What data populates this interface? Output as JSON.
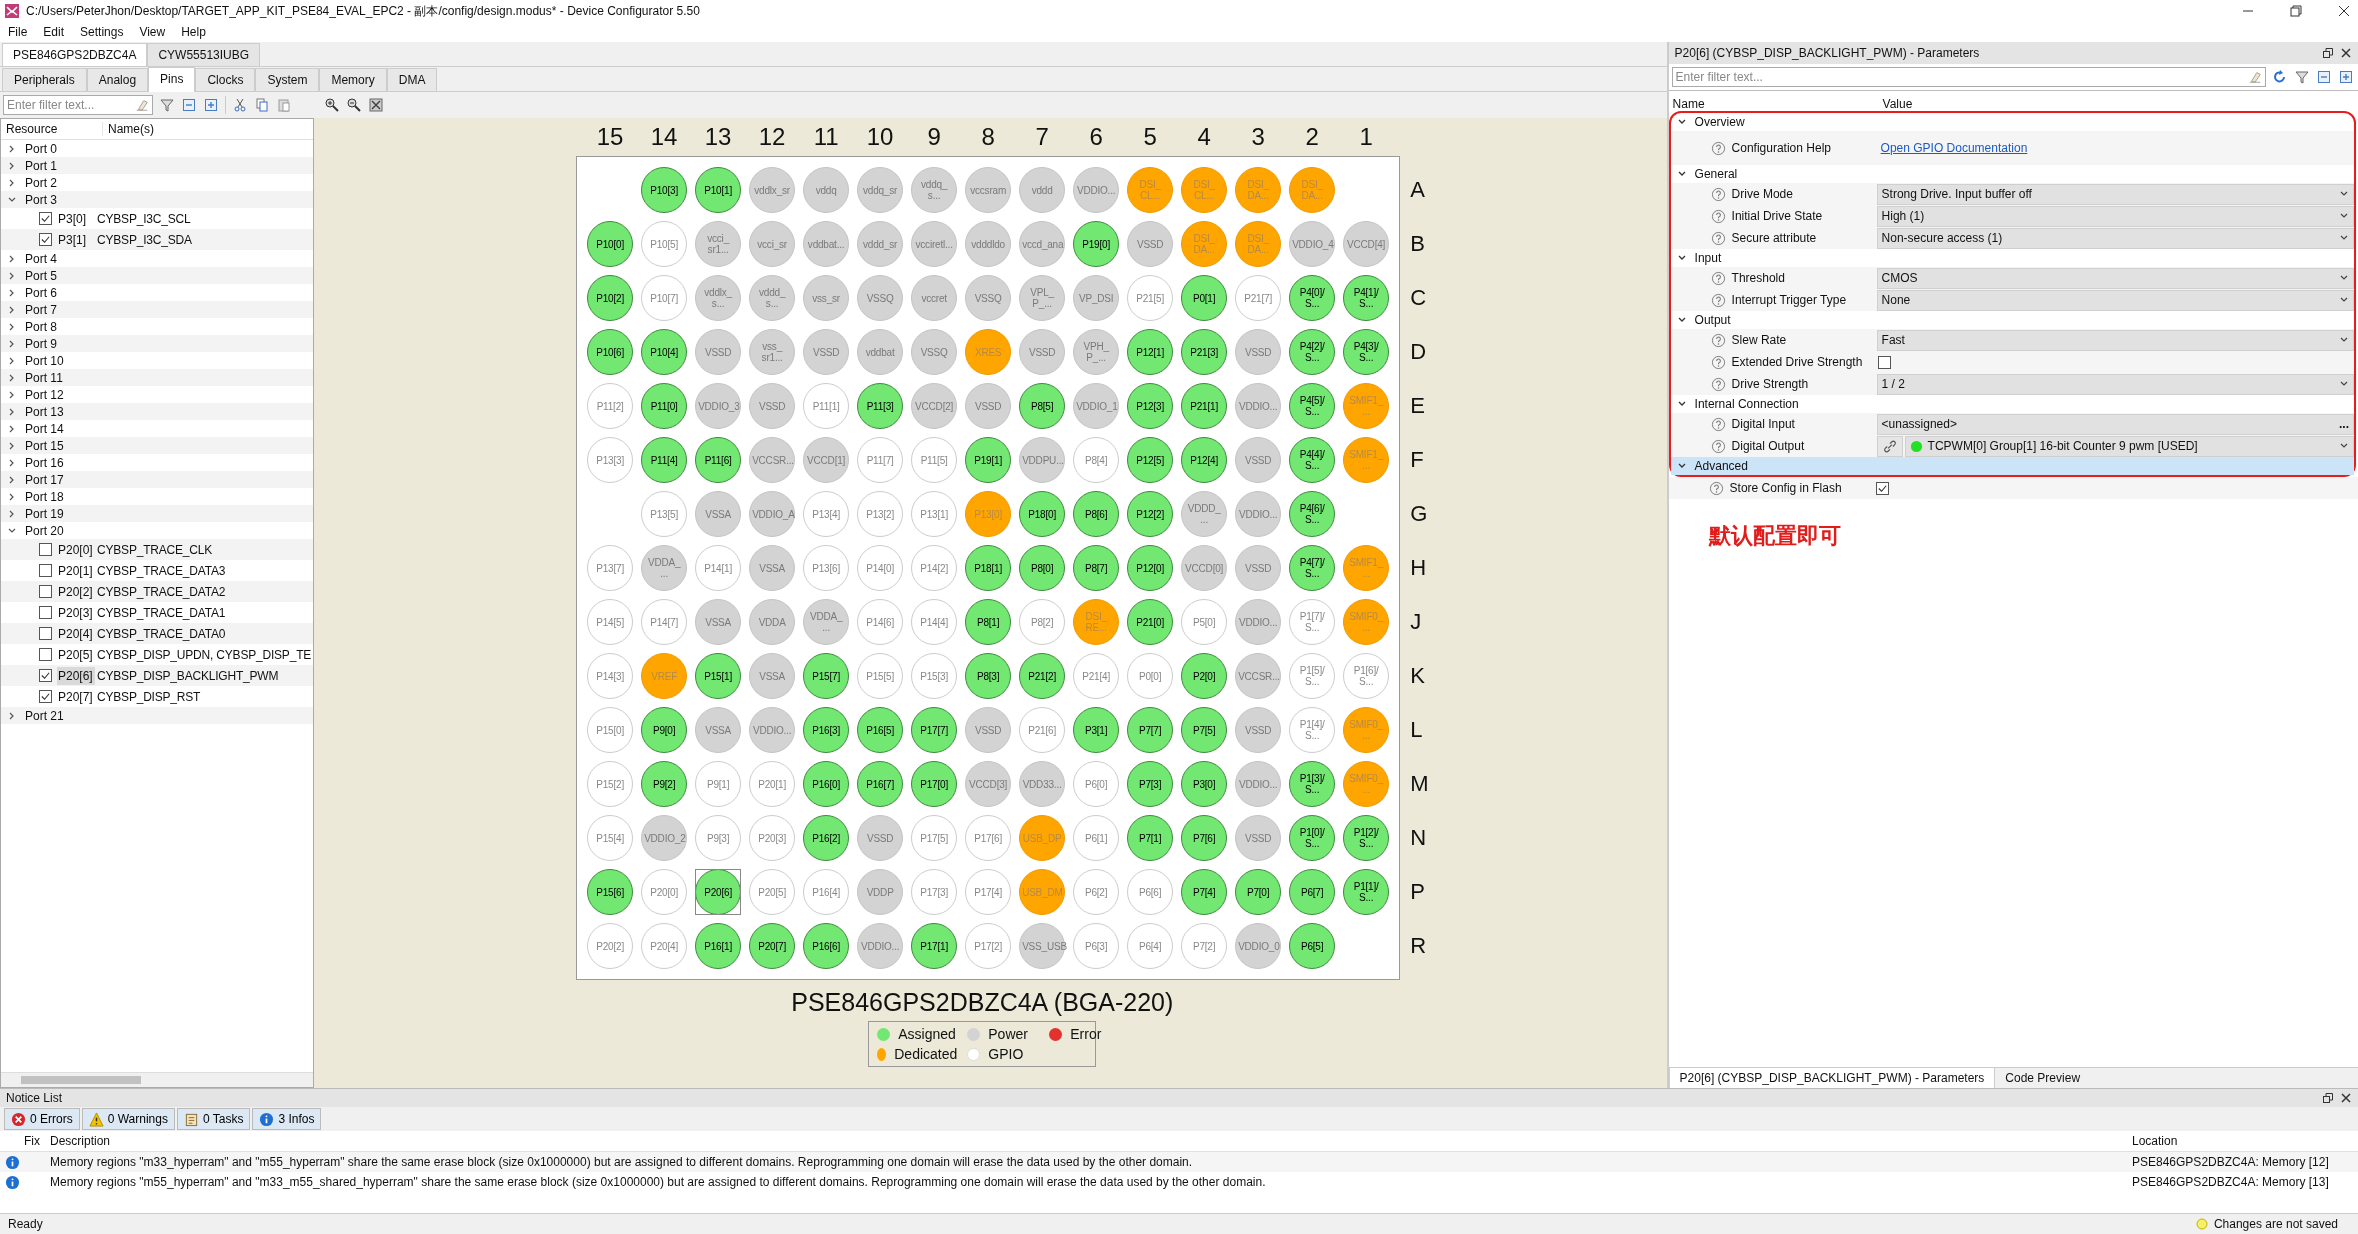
{
  "window": {
    "title": "C:/Users/PeterJhon/Desktop/TARGET_APP_KIT_PSE84_EVAL_EPC2 - 副本/config/design.modus* - Device Configurator 5.50"
  },
  "menu": [
    "File",
    "Edit",
    "Settings",
    "View",
    "Help"
  ],
  "device_tabs": [
    {
      "label": "PSE846GPS2DBZC4A",
      "selected": true
    },
    {
      "label": "CYW55513IUBG",
      "selected": false
    }
  ],
  "view_tabs": [
    {
      "label": "Peripherals",
      "selected": false
    },
    {
      "label": "Analog",
      "selected": false
    },
    {
      "label": "Pins",
      "selected": true
    },
    {
      "label": "Clocks",
      "selected": false
    },
    {
      "label": "System",
      "selected": false
    },
    {
      "label": "Memory",
      "selected": false
    },
    {
      "label": "DMA",
      "selected": false
    }
  ],
  "resource_filter": {
    "placeholder": "Enter filter text..."
  },
  "tree": {
    "columns": [
      "Resource",
      "Name(s)"
    ],
    "items": [
      {
        "label": "Port 0",
        "expanded": false
      },
      {
        "label": "Port 1",
        "expanded": false
      },
      {
        "label": "Port 2",
        "expanded": false
      },
      {
        "label": "Port 3",
        "expanded": true,
        "children": [
          {
            "label": "P3[0]",
            "name": "CYBSP_I3C_SCL",
            "checked": true,
            "selected": false
          },
          {
            "label": "P3[1]",
            "name": "CYBSP_I3C_SDA",
            "checked": true,
            "selected": false
          }
        ]
      },
      {
        "label": "Port 4",
        "expanded": false
      },
      {
        "label": "Port 5",
        "expanded": false
      },
      {
        "label": "Port 6",
        "expanded": false
      },
      {
        "label": "Port 7",
        "expanded": false
      },
      {
        "label": "Port 8",
        "expanded": false
      },
      {
        "label": "Port 9",
        "expanded": false
      },
      {
        "label": "Port 10",
        "expanded": false
      },
      {
        "label": "Port 11",
        "expanded": false
      },
      {
        "label": "Port 12",
        "expanded": false
      },
      {
        "label": "Port 13",
        "expanded": false
      },
      {
        "label": "Port 14",
        "expanded": false
      },
      {
        "label": "Port 15",
        "expanded": false
      },
      {
        "label": "Port 16",
        "expanded": false
      },
      {
        "label": "Port 17",
        "expanded": false
      },
      {
        "label": "Port 18",
        "expanded": false
      },
      {
        "label": "Port 19",
        "expanded": false
      },
      {
        "label": "Port 20",
        "expanded": true,
        "children": [
          {
            "label": "P20[0]",
            "name": "CYBSP_TRACE_CLK",
            "checked": false,
            "selected": false
          },
          {
            "label": "P20[1]",
            "name": "CYBSP_TRACE_DATA3",
            "checked": false,
            "selected": false
          },
          {
            "label": "P20[2]",
            "name": "CYBSP_TRACE_DATA2",
            "checked": false,
            "selected": false
          },
          {
            "label": "P20[3]",
            "name": "CYBSP_TRACE_DATA1",
            "checked": false,
            "selected": false
          },
          {
            "label": "P20[4]",
            "name": "CYBSP_TRACE_DATA0",
            "checked": false,
            "selected": false
          },
          {
            "label": "P20[5]",
            "name": "CYBSP_DISP_UPDN, CYBSP_DISP_TE",
            "checked": false,
            "selected": false
          },
          {
            "label": "P20[6]",
            "name": "CYBSP_DISP_BACKLIGHT_PWM",
            "checked": true,
            "selected": true
          },
          {
            "label": "P20[7]",
            "name": "CYBSP_DISP_RST",
            "checked": true,
            "selected": false
          }
        ]
      },
      {
        "label": "Port 21",
        "expanded": false
      }
    ]
  },
  "pin_grid": {
    "columns": [
      "15",
      "14",
      "13",
      "12",
      "11",
      "10",
      "9",
      "8",
      "7",
      "6",
      "5",
      "4",
      "3",
      "2",
      "1"
    ],
    "rows": [
      {
        "label": "A",
        "pins": [
          {
            "kind": "empty"
          },
          {
            "label": "P10[3]",
            "kind": "assigned",
            "selected": false
          },
          {
            "label": "P10[1]",
            "kind": "assigned",
            "selected": false
          },
          {
            "label": "vddlx_sr",
            "kind": "power",
            "selected": false
          },
          {
            "label": "vddq",
            "kind": "power",
            "selected": false
          },
          {
            "label": "vddq_sr",
            "kind": "power",
            "selected": false
          },
          {
            "label": "vddq_ s...",
            "kind": "power",
            "selected": false
          },
          {
            "label": "vccsram",
            "kind": "power",
            "selected": false
          },
          {
            "label": "vddd",
            "kind": "power",
            "selected": false
          },
          {
            "label": "VDDIO...",
            "kind": "power",
            "selected": false
          },
          {
            "label": "DSI_ CL...",
            "kind": "dedicated",
            "selected": false
          },
          {
            "label": "DSI_ CL...",
            "kind": "dedicated",
            "selected": false
          },
          {
            "label": "DSI_ DA...",
            "kind": "dedicated",
            "selected": false
          },
          {
            "label": "DSI_ DA...",
            "kind": "dedicated",
            "selected": false
          },
          {
            "kind": "empty"
          }
        ]
      },
      {
        "label": "B",
        "pins": [
          {
            "label": "P10[0]",
            "kind": "assigned",
            "selected": false
          },
          {
            "label": "P10[5]",
            "kind": "gpio",
            "selected": false
          },
          {
            "label": "vcci_ sr1...",
            "kind": "power",
            "selected": false
          },
          {
            "label": "vcci_sr",
            "kind": "power",
            "selected": false
          },
          {
            "label": "vddbat...",
            "kind": "power",
            "selected": false
          },
          {
            "label": "vddd_sr",
            "kind": "power",
            "selected": false
          },
          {
            "label": "vcciretl...",
            "kind": "power",
            "selected": false
          },
          {
            "label": "vdddldo",
            "kind": "power",
            "selected": false
          },
          {
            "label": "vccd_ana",
            "kind": "power",
            "selected": false
          },
          {
            "label": "P19[0]",
            "kind": "assigned",
            "selected": false
          },
          {
            "label": "VSSD",
            "kind": "power",
            "selected": false
          },
          {
            "label": "DSI_ DA...",
            "kind": "dedicated",
            "selected": false
          },
          {
            "label": "DSI_ DA...",
            "kind": "dedicated",
            "selected": false
          },
          {
            "label": "VDDIO_4",
            "kind": "power",
            "selected": false
          },
          {
            "label": "VCCD[4]",
            "kind": "power",
            "selected": false
          }
        ]
      },
      {
        "label": "C",
        "pins": [
          {
            "label": "P10[2]",
            "kind": "assigned",
            "selected": false
          },
          {
            "label": "P10[7]",
            "kind": "gpio",
            "selected": false
          },
          {
            "label": "vddlx_ s...",
            "kind": "power",
            "selected": false
          },
          {
            "label": "vddd_ s...",
            "kind": "power",
            "selected": false
          },
          {
            "label": "vss_sr",
            "kind": "power",
            "selected": false
          },
          {
            "label": "VSSQ",
            "kind": "power",
            "selected": false
          },
          {
            "label": "vccret",
            "kind": "power",
            "selected": false
          },
          {
            "label": "VSSQ",
            "kind": "power",
            "selected": false
          },
          {
            "label": "VPL_ P_...",
            "kind": "power",
            "selected": false
          },
          {
            "label": "VP_DSI",
            "kind": "power",
            "selected": false
          },
          {
            "label": "P21[5]",
            "kind": "gpio",
            "selected": false
          },
          {
            "label": "P0[1]",
            "kind": "assigned",
            "selected": false
          },
          {
            "label": "P21[7]",
            "kind": "gpio",
            "selected": false
          },
          {
            "label": "P4[0]/ S...",
            "kind": "assigned",
            "selected": false
          },
          {
            "label": "P4[1]/ S...",
            "kind": "assigned",
            "selected": false
          }
        ]
      },
      {
        "label": "D",
        "pins": [
          {
            "label": "P10[6]",
            "kind": "assigned",
            "selected": false
          },
          {
            "label": "P10[4]",
            "kind": "assigned",
            "selected": false
          },
          {
            "label": "VSSD",
            "kind": "power",
            "selected": false
          },
          {
            "label": "vss_ sr1...",
            "kind": "power",
            "selected": false
          },
          {
            "label": "VSSD",
            "kind": "power",
            "selected": false
          },
          {
            "label": "vddbat",
            "kind": "power",
            "selected": false
          },
          {
            "label": "VSSQ",
            "kind": "power",
            "selected": false
          },
          {
            "label": "XRES",
            "kind": "dedicated",
            "selected": false
          },
          {
            "label": "VSSD",
            "kind": "power",
            "selected": false
          },
          {
            "label": "VPH_ P_...",
            "kind": "power",
            "selected": false
          },
          {
            "label": "P12[1]",
            "kind": "assigned",
            "selected": false
          },
          {
            "label": "P21[3]",
            "kind": "assigned",
            "selected": false
          },
          {
            "label": "VSSD",
            "kind": "power",
            "selected": false
          },
          {
            "label": "P4[2]/ S...",
            "kind": "assigned",
            "selected": false
          },
          {
            "label": "P4[3]/ S...",
            "kind": "assigned",
            "selected": false
          }
        ]
      },
      {
        "label": "E",
        "pins": [
          {
            "label": "P11[2]",
            "kind": "gpio",
            "selected": false
          },
          {
            "label": "P11[0]",
            "kind": "assigned",
            "selected": false
          },
          {
            "label": "VDDIO_3",
            "kind": "power",
            "selected": false
          },
          {
            "label": "VSSD",
            "kind": "power",
            "selected": false
          },
          {
            "label": "P11[1]",
            "kind": "gpio",
            "selected": false
          },
          {
            "label": "P11[3]",
            "kind": "assigned",
            "selected": false
          },
          {
            "label": "VCCD[2]",
            "kind": "power",
            "selected": false
          },
          {
            "label": "VSSD",
            "kind": "power",
            "selected": false
          },
          {
            "label": "P8[5]",
            "kind": "assigned",
            "selected": false
          },
          {
            "label": "VDDIO_1",
            "kind": "power",
            "selected": false
          },
          {
            "label": "P12[3]",
            "kind": "assigned",
            "selected": false
          },
          {
            "label": "P21[1]",
            "kind": "assigned",
            "selected": false
          },
          {
            "label": "VDDIO...",
            "kind": "power",
            "selected": false
          },
          {
            "label": "P4[5]/ S...",
            "kind": "assigned",
            "selected": false
          },
          {
            "label": "SMIF1_ ...",
            "kind": "dedicated",
            "selected": false
          }
        ]
      },
      {
        "label": "F",
        "pins": [
          {
            "label": "P13[3]",
            "kind": "gpio",
            "selected": false
          },
          {
            "label": "P11[4]",
            "kind": "assigned",
            "selected": false
          },
          {
            "label": "P11[6]",
            "kind": "assigned",
            "selected": false
          },
          {
            "label": "VCCSR...",
            "kind": "power",
            "selected": false
          },
          {
            "label": "VCCD[1]",
            "kind": "power",
            "selected": false
          },
          {
            "label": "P11[7]",
            "kind": "gpio",
            "selected": false
          },
          {
            "label": "P11[5]",
            "kind": "gpio",
            "selected": false
          },
          {
            "label": "P19[1]",
            "kind": "assigned",
            "selected": false
          },
          {
            "label": "VDDPU...",
            "kind": "power",
            "selected": false
          },
          {
            "label": "P8[4]",
            "kind": "gpio",
            "selected": false
          },
          {
            "label": "P12[5]",
            "kind": "assigned",
            "selected": false
          },
          {
            "label": "P12[4]",
            "kind": "assigned",
            "selected": false
          },
          {
            "label": "VSSD",
            "kind": "power",
            "selected": false
          },
          {
            "label": "P4[4]/ S...",
            "kind": "assigned",
            "selected": false
          },
          {
            "label": "SMIF1_ ...",
            "kind": "dedicated",
            "selected": false
          }
        ]
      },
      {
        "label": "G",
        "pins": [
          {
            "kind": "empty"
          },
          {
            "label": "P13[5]",
            "kind": "gpio",
            "selected": false
          },
          {
            "label": "VSSA",
            "kind": "power",
            "selected": false
          },
          {
            "label": "VDDIO_A",
            "kind": "power",
            "selected": false
          },
          {
            "label": "P13[4]",
            "kind": "gpio",
            "selected": false
          },
          {
            "label": "P13[2]",
            "kind": "gpio",
            "selected": false
          },
          {
            "label": "P13[1]",
            "kind": "gpio",
            "selected": false
          },
          {
            "label": "P13[0]",
            "kind": "dedicated",
            "selected": false
          },
          {
            "label": "P18[0]",
            "kind": "assigned",
            "selected": false
          },
          {
            "label": "P8[6]",
            "kind": "assigned",
            "selected": false
          },
          {
            "label": "P12[2]",
            "kind": "assigned",
            "selected": false
          },
          {
            "label": "VDDD_ ...",
            "kind": "power",
            "selected": false
          },
          {
            "label": "VDDIO...",
            "kind": "power",
            "selected": false
          },
          {
            "label": "P4[6]/ S...",
            "kind": "assigned",
            "selected": false
          },
          {
            "kind": "empty"
          }
        ]
      },
      {
        "label": "H",
        "pins": [
          {
            "label": "P13[7]",
            "kind": "gpio",
            "selected": false
          },
          {
            "label": "VDDA_ ...",
            "kind": "power",
            "selected": false
          },
          {
            "label": "P14[1]",
            "kind": "gpio",
            "selected": false
          },
          {
            "label": "VSSA",
            "kind": "power",
            "selected": false
          },
          {
            "label": "P13[6]",
            "kind": "gpio",
            "selected": false
          },
          {
            "label": "P14[0]",
            "kind": "gpio",
            "selected": false
          },
          {
            "label": "P14[2]",
            "kind": "gpio",
            "selected": false
          },
          {
            "label": "P18[1]",
            "kind": "assigned",
            "selected": false
          },
          {
            "label": "P8[0]",
            "kind": "assigned",
            "selected": false
          },
          {
            "label": "P8[7]",
            "kind": "assigned",
            "selected": false
          },
          {
            "label": "P12[0]",
            "kind": "assigned",
            "selected": false
          },
          {
            "label": "VCCD[0]",
            "kind": "power",
            "selected": false
          },
          {
            "label": "VSSD",
            "kind": "power",
            "selected": false
          },
          {
            "label": "P4[7]/ S...",
            "kind": "assigned",
            "selected": false
          },
          {
            "label": "SMIF1_ ...",
            "kind": "dedicated",
            "selected": false
          }
        ]
      },
      {
        "label": "J",
        "pins": [
          {
            "label": "P14[5]",
            "kind": "gpio",
            "selected": false
          },
          {
            "label": "P14[7]",
            "kind": "gpio",
            "selected": false
          },
          {
            "label": "VSSA",
            "kind": "power",
            "selected": false
          },
          {
            "label": "VDDA",
            "kind": "power",
            "selected": false
          },
          {
            "label": "VDDA_ ...",
            "kind": "power",
            "selected": false
          },
          {
            "label": "P14[6]",
            "kind": "gpio",
            "selected": false
          },
          {
            "label": "P14[4]",
            "kind": "gpio",
            "selected": false
          },
          {
            "label": "P8[1]",
            "kind": "assigned",
            "selected": false
          },
          {
            "label": "P8[2]",
            "kind": "gpio",
            "selected": false
          },
          {
            "label": "DSI_ RE...",
            "kind": "dedicated",
            "selected": false
          },
          {
            "label": "P21[0]",
            "kind": "assigned",
            "selected": false
          },
          {
            "label": "P5[0]",
            "kind": "gpio",
            "selected": false
          },
          {
            "label": "VDDIO...",
            "kind": "power",
            "selected": false
          },
          {
            "label": "P1[7]/ S...",
            "kind": "gpio",
            "selected": false
          },
          {
            "label": "SMIF0_ ...",
            "kind": "dedicated",
            "selected": false
          }
        ]
      },
      {
        "label": "K",
        "pins": [
          {
            "label": "P14[3]",
            "kind": "gpio",
            "selected": false
          },
          {
            "label": "VREF",
            "kind": "dedicated",
            "selected": false
          },
          {
            "label": "P15[1]",
            "kind": "assigned",
            "selected": false
          },
          {
            "label": "VSSA",
            "kind": "power",
            "selected": false
          },
          {
            "label": "P15[7]",
            "kind": "assigned",
            "selected": false
          },
          {
            "label": "P15[5]",
            "kind": "gpio",
            "selected": false
          },
          {
            "label": "P15[3]",
            "kind": "gpio",
            "selected": false
          },
          {
            "label": "P8[3]",
            "kind": "assigned",
            "selected": false
          },
          {
            "label": "P21[2]",
            "kind": "assigned",
            "selected": false
          },
          {
            "label": "P21[4]",
            "kind": "gpio",
            "selected": false
          },
          {
            "label": "P0[0]",
            "kind": "gpio",
            "selected": false
          },
          {
            "label": "P2[0]",
            "kind": "assigned",
            "selected": false
          },
          {
            "label": "VCCSR...",
            "kind": "power",
            "selected": false
          },
          {
            "label": "P1[5]/ S...",
            "kind": "gpio",
            "selected": false
          },
          {
            "label": "P1[6]/ S...",
            "kind": "gpio",
            "selected": false
          }
        ]
      },
      {
        "label": "L",
        "pins": [
          {
            "label": "P15[0]",
            "kind": "gpio",
            "selected": false
          },
          {
            "label": "P9[0]",
            "kind": "assigned",
            "selected": false
          },
          {
            "label": "VSSA",
            "kind": "power",
            "selected": false
          },
          {
            "label": "VDDIO...",
            "kind": "power",
            "selected": false
          },
          {
            "label": "P16[3]",
            "kind": "assigned",
            "selected": false
          },
          {
            "label": "P16[5]",
            "kind": "assigned",
            "selected": false
          },
          {
            "label": "P17[7]",
            "kind": "assigned",
            "selected": false
          },
          {
            "label": "VSSD",
            "kind": "power",
            "selected": false
          },
          {
            "label": "P21[6]",
            "kind": "gpio",
            "selected": false
          },
          {
            "label": "P3[1]",
            "kind": "assigned",
            "selected": false
          },
          {
            "label": "P7[7]",
            "kind": "assigned",
            "selected": false
          },
          {
            "label": "P7[5]",
            "kind": "assigned",
            "selected": false
          },
          {
            "label": "VSSD",
            "kind": "power",
            "selected": false
          },
          {
            "label": "P1[4]/ S...",
            "kind": "gpio",
            "selected": false
          },
          {
            "label": "SMIF0_ ...",
            "kind": "dedicated",
            "selected": false
          }
        ]
      },
      {
        "label": "M",
        "pins": [
          {
            "label": "P15[2]",
            "kind": "gpio",
            "selected": false
          },
          {
            "label": "P9[2]",
            "kind": "assigned",
            "selected": false
          },
          {
            "label": "P9[1]",
            "kind": "gpio",
            "selected": false
          },
          {
            "label": "P20[1]",
            "kind": "gpio",
            "selected": false
          },
          {
            "label": "P16[0]",
            "kind": "assigned",
            "selected": false
          },
          {
            "label": "P16[7]",
            "kind": "assigned",
            "selected": false
          },
          {
            "label": "P17[0]",
            "kind": "assigned",
            "selected": false
          },
          {
            "label": "VCCD[3]",
            "kind": "power",
            "selected": false
          },
          {
            "label": "VDD33...",
            "kind": "power",
            "selected": false
          },
          {
            "label": "P6[0]",
            "kind": "gpio",
            "selected": false
          },
          {
            "label": "P7[3]",
            "kind": "assigned",
            "selected": false
          },
          {
            "label": "P3[0]",
            "kind": "assigned",
            "selected": false
          },
          {
            "label": "VDDIO...",
            "kind": "power",
            "selected": false
          },
          {
            "label": "P1[3]/ S...",
            "kind": "assigned",
            "selected": false
          },
          {
            "label": "SMIF0_ ...",
            "kind": "dedicated",
            "selected": false
          }
        ]
      },
      {
        "label": "N",
        "pins": [
          {
            "label": "P15[4]",
            "kind": "gpio",
            "selected": false
          },
          {
            "label": "VDDIO_2",
            "kind": "power",
            "selected": false
          },
          {
            "label": "P9[3]",
            "kind": "gpio",
            "selected": false
          },
          {
            "label": "P20[3]",
            "kind": "gpio",
            "selected": false
          },
          {
            "label": "P16[2]",
            "kind": "assigned",
            "selected": false
          },
          {
            "label": "VSSD",
            "kind": "power",
            "selected": false
          },
          {
            "label": "P17[5]",
            "kind": "gpio",
            "selected": false
          },
          {
            "label": "P17[6]",
            "kind": "gpio",
            "selected": false
          },
          {
            "label": "USB_DP",
            "kind": "dedicated",
            "selected": false
          },
          {
            "label": "P6[1]",
            "kind": "gpio",
            "selected": false
          },
          {
            "label": "P7[1]",
            "kind": "assigned",
            "selected": false
          },
          {
            "label": "P7[6]",
            "kind": "assigned",
            "selected": false
          },
          {
            "label": "VSSD",
            "kind": "power",
            "selected": false
          },
          {
            "label": "P1[0]/ S...",
            "kind": "assigned",
            "selected": false
          },
          {
            "label": "P1[2]/ S...",
            "kind": "assigned",
            "selected": false
          }
        ]
      },
      {
        "label": "P",
        "pins": [
          {
            "label": "P15[6]",
            "kind": "assigned",
            "selected": false
          },
          {
            "label": "P20[0]",
            "kind": "gpio",
            "selected": false
          },
          {
            "label": "P20[6]",
            "kind": "assigned",
            "selected": true
          },
          {
            "label": "P20[5]",
            "kind": "gpio",
            "selected": false
          },
          {
            "label": "P16[4]",
            "kind": "gpio",
            "selected": false
          },
          {
            "label": "VDDP",
            "kind": "power",
            "selected": false
          },
          {
            "label": "P17[3]",
            "kind": "gpio",
            "selected": false
          },
          {
            "label": "P17[4]",
            "kind": "gpio",
            "selected": false
          },
          {
            "label": "USB_DM",
            "kind": "dedicated",
            "selected": false
          },
          {
            "label": "P6[2]",
            "kind": "gpio",
            "selected": false
          },
          {
            "label": "P6[6]",
            "kind": "gpio",
            "selected": false
          },
          {
            "label": "P7[4]",
            "kind": "assigned",
            "selected": false
          },
          {
            "label": "P7[0]",
            "kind": "assigned",
            "selected": false
          },
          {
            "label": "P6[7]",
            "kind": "assigned",
            "selected": false
          },
          {
            "label": "P1[1]/ S...",
            "kind": "assigned",
            "selected": false
          }
        ]
      },
      {
        "label": "R",
        "pins": [
          {
            "label": "P20[2]",
            "kind": "gpio",
            "selected": false
          },
          {
            "label": "P20[4]",
            "kind": "gpio",
            "selected": false
          },
          {
            "label": "P16[1]",
            "kind": "assigned",
            "selected": false
          },
          {
            "label": "P20[7]",
            "kind": "assigned",
            "selected": false
          },
          {
            "label": "P16[6]",
            "kind": "assigned",
            "selected": false
          },
          {
            "label": "VDDIO...",
            "kind": "power",
            "selected": false
          },
          {
            "label": "P17[1]",
            "kind": "assigned",
            "selected": false
          },
          {
            "label": "P17[2]",
            "kind": "gpio",
            "selected": false
          },
          {
            "label": "VSS_USB",
            "kind": "power",
            "selected": false
          },
          {
            "label": "P6[3]",
            "kind": "gpio",
            "selected": false
          },
          {
            "label": "P6[4]",
            "kind": "gpio",
            "selected": false
          },
          {
            "label": "P7[2]",
            "kind": "gpio",
            "selected": false
          },
          {
            "label": "VDDIO_0",
            "kind": "power",
            "selected": false
          },
          {
            "label": "P6[5]",
            "kind": "assigned",
            "selected": false
          },
          {
            "kind": "empty"
          }
        ]
      }
    ]
  },
  "package_title": "PSE846GPS2DBZC4A (BGA-220)",
  "legend": [
    {
      "label": "Assigned",
      "kind": "assigned"
    },
    {
      "label": "Power",
      "kind": "power"
    },
    {
      "label": "Error",
      "kind": "error"
    },
    {
      "label": "Dedicated",
      "kind": "dedicated"
    },
    {
      "label": "GPIO",
      "kind": "gpio"
    }
  ],
  "parameters": {
    "title": "P20[6] (CYBSP_DISP_BACKLIGHT_PWM) - Parameters",
    "filter": {
      "placeholder": "Enter filter text..."
    },
    "columns": [
      "Name",
      "Value"
    ],
    "groups": [
      {
        "label": "Overview",
        "expanded": true,
        "selected": false,
        "params": [
          {
            "name": "Configuration Help",
            "kind": "link",
            "value": "Open GPIO Documentation"
          }
        ]
      },
      {
        "label": "General",
        "expanded": true,
        "selected": false,
        "params": [
          {
            "name": "Drive Mode",
            "kind": "dropdown",
            "value": "Strong Drive. Input buffer off"
          },
          {
            "name": "Initial Drive State",
            "kind": "dropdown",
            "value": "High (1)"
          },
          {
            "name": "Secure attribute",
            "kind": "dropdown",
            "value": "Non-secure access (1)"
          }
        ]
      },
      {
        "label": "Input",
        "expanded": true,
        "selected": false,
        "params": [
          {
            "name": "Threshold",
            "kind": "dropdown",
            "value": "CMOS"
          },
          {
            "name": "Interrupt Trigger Type",
            "kind": "dropdown",
            "value": "None"
          }
        ]
      },
      {
        "label": "Output",
        "expanded": true,
        "selected": false,
        "params": [
          {
            "name": "Slew Rate",
            "kind": "dropdown",
            "value": "Fast"
          },
          {
            "name": "Extended Drive Strength",
            "kind": "checkbox",
            "checked": false
          },
          {
            "name": "Drive Strength",
            "kind": "dropdown",
            "value": "1 / 2"
          }
        ]
      },
      {
        "label": "Internal Connection",
        "expanded": true,
        "selected": false,
        "params": [
          {
            "name": "Digital Input",
            "kind": "picker",
            "value": "<unassigned>",
            "button_label": "..."
          },
          {
            "name": "Digital Output",
            "kind": "connection",
            "value": "TCPWM[0] Group[1] 16-bit Counter 9 pwm [USED]"
          }
        ]
      },
      {
        "label": "Advanced",
        "expanded": true,
        "selected": true,
        "params": [
          {
            "name": "Store Config in Flash",
            "kind": "checkbox",
            "checked": true
          }
        ]
      }
    ],
    "annotation": "默认配置即可",
    "bottom_tabs": [
      {
        "label": "P20[6] (CYBSP_DISP_BACKLIGHT_PWM) - Parameters",
        "selected": true
      },
      {
        "label": "Code Preview",
        "selected": false
      }
    ]
  },
  "notice_list": {
    "title": "Notice List",
    "filters": [
      {
        "label": "0 Errors",
        "kind": "error"
      },
      {
        "label": "0 Warnings",
        "kind": "warning"
      },
      {
        "label": "0 Tasks",
        "kind": "task"
      },
      {
        "label": "3 Infos",
        "kind": "info"
      }
    ],
    "columns": [
      "Fix",
      "Description",
      "Location"
    ],
    "rows": [
      {
        "kind": "info",
        "description": "Memory regions \"m33_hyperram\" and \"m55_hyperram\" share the same erase block (size 0x1000000) but are assigned to different domains. Reprogramming one domain will erase the data used by the other domain.",
        "location": "PSE846GPS2DBZC4A: Memory [12]"
      },
      {
        "kind": "info",
        "description": "Memory regions \"m55_hyperram\" and \"m33_m55_shared_hyperram\" share the same erase block (size 0x1000000) but are assigned to different domains. Reprogramming one domain will erase the data used by the other domain.",
        "location": "PSE846GPS2DBZC4A: Memory [13]"
      }
    ]
  },
  "status_bar": {
    "left": "Ready",
    "right": "Changes are not saved"
  }
}
